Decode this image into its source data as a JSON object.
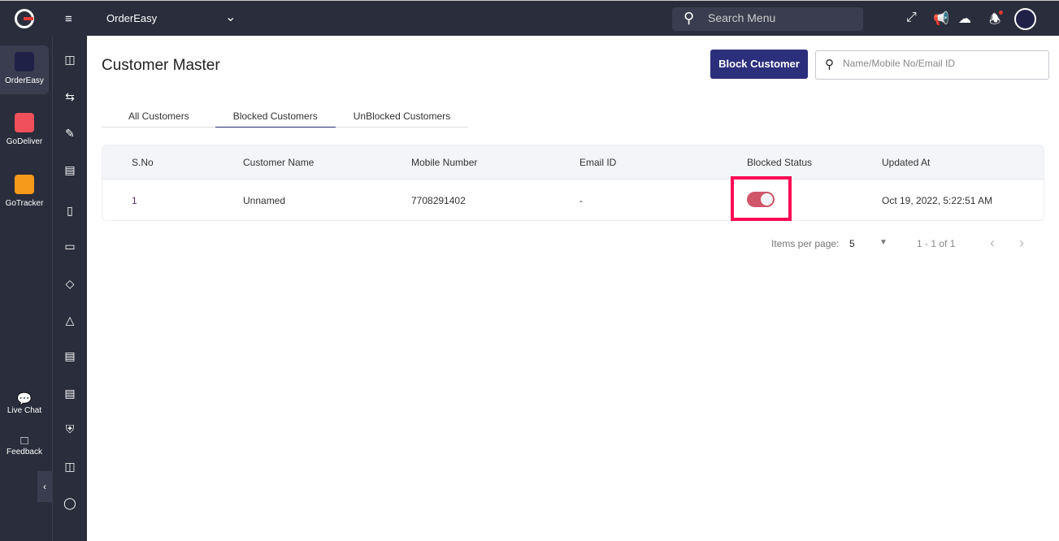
{
  "header": {
    "brand": "OrderEasy",
    "search_placeholder": "Search Menu"
  },
  "apps": [
    {
      "label": "OrderEasy",
      "color": "#1f2147"
    },
    {
      "label": "GoDeliver",
      "color": "#f0505c"
    },
    {
      "label": "GoTracker",
      "color": "#f59a1a"
    }
  ],
  "support": {
    "live_chat": "Live Chat",
    "feedback": "Feedback"
  },
  "page": {
    "title": "Customer Master",
    "block_button": "Block Customer",
    "search_placeholder": "Name/Mobile No/Email ID"
  },
  "tabs": [
    "All Customers",
    "Blocked Customers",
    "UnBlocked Customers"
  ],
  "table": {
    "columns": [
      "S.No",
      "Customer Name",
      "Mobile Number",
      "Email ID",
      "Blocked Status",
      "Updated At"
    ],
    "rows": [
      {
        "sno": "1",
        "name": "Unnamed",
        "mobile": "7708291402",
        "email": "-",
        "blocked": true,
        "updated": "Oct 19, 2022, 5:22:51 AM"
      }
    ]
  },
  "pagination": {
    "items_label": "Items per page:",
    "items_value": "5",
    "range": "1 - 1 of 1"
  }
}
